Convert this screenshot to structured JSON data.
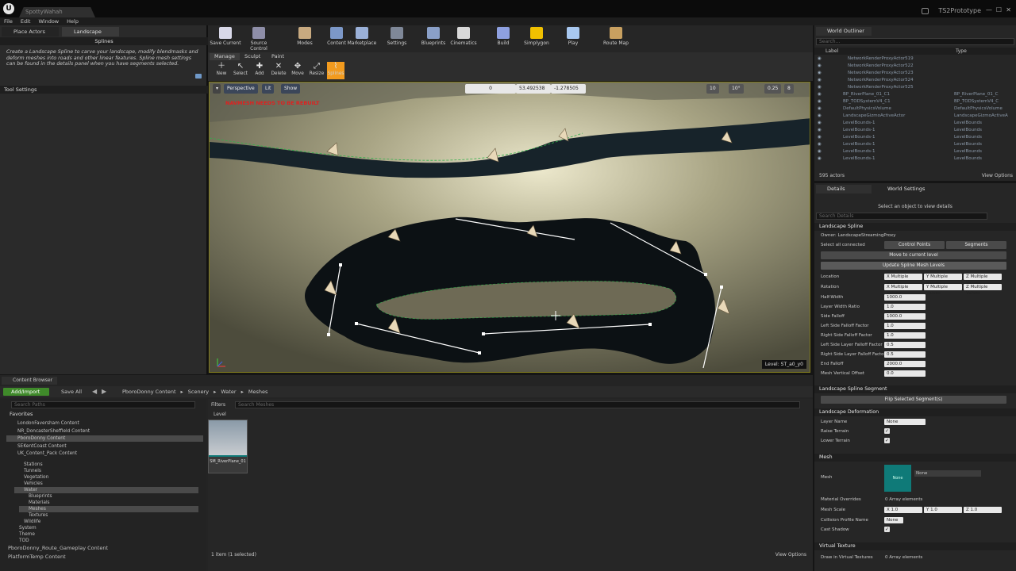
{
  "titlebar": {
    "doc_tab": "SpottyWahah",
    "project": "TS2Prototype"
  },
  "menu": [
    "File",
    "Edit",
    "Window",
    "Help"
  ],
  "left_panel": {
    "tabs": [
      "Place Actors",
      "Landscape"
    ],
    "header": "Splines",
    "description": "Create a Landscape Spline to carve your landscape, modify blendmasks and deform meshes into roads and other linear features.  Spline mesh settings can be found in the details panel when you have  segments selected.",
    "tool_settings": "Tool Settings"
  },
  "toolbar": [
    {
      "label": "Save Current",
      "color": "#d8d8e8"
    },
    {
      "label": "Source Control",
      "color": "#8e8ea8"
    },
    {
      "label": "Modes",
      "color": "#c8aa80"
    },
    {
      "label": "Content",
      "color": "#7c98c8"
    },
    {
      "label": "Marketplace",
      "color": "#9ab0d8"
    },
    {
      "label": "Settings",
      "color": "#7f8898"
    },
    {
      "label": "Blueprints",
      "color": "#8aa0c8"
    },
    {
      "label": "Cinematics",
      "color": "#d8d8d8"
    },
    {
      "label": "Build",
      "color": "#8ea0e0"
    },
    {
      "label": "Simplygon",
      "color": "#f0c000"
    },
    {
      "label": "Play",
      "color": "#a8c8f0"
    },
    {
      "label": "Route Map",
      "color": "#c8a060"
    }
  ],
  "modes": {
    "tabs": [
      "Manage",
      "Sculpt",
      "Paint"
    ],
    "tools": [
      "New",
      "Select",
      "Add",
      "Delete",
      "Move",
      "Resize",
      "Splines"
    ]
  },
  "viewport": {
    "perspective": "Perspective",
    "lit": "Lit",
    "show": "Show",
    "coord_x": "0",
    "coord_y": "53.492538",
    "coord_z": "-1.278505",
    "grid": "10",
    "rot": "10°",
    "scale": "0.25",
    "cam": "8",
    "warning": "NAVMESH NEEDS TO BE REBUILT",
    "level": "Level:  ST_a0_y0"
  },
  "outliner": {
    "title": "World Outliner",
    "search": "Search...",
    "col_label": "Label",
    "col_type": "Type",
    "rows": [
      {
        "label": "NetworkRenderProxyActor519",
        "type": ""
      },
      {
        "label": "NetworkRenderProxyActor522",
        "type": ""
      },
      {
        "label": "NetworkRenderProxyActor523",
        "type": ""
      },
      {
        "label": "NetworkRenderProxyActor524",
        "type": ""
      },
      {
        "label": "NetworkRenderProxyActor525",
        "type": ""
      },
      {
        "label": "BP_RiverPlane_01_C1",
        "type": "BP_RiverPlane_01_C"
      },
      {
        "label": "BP_TODSystemV4_C1",
        "type": "BP_TODSystemV4_C"
      },
      {
        "label": "DefaultPhysicsVolume",
        "type": "DefaultPhysicsVolume"
      },
      {
        "label": "LandscapeGizmoActiveActor",
        "type": "LandscapeGizmoActiveA"
      },
      {
        "label": "LevelBounds-1",
        "type": "LevelBounds"
      },
      {
        "label": "LevelBounds-1",
        "type": "LevelBounds"
      },
      {
        "label": "LevelBounds-1",
        "type": "LevelBounds"
      },
      {
        "label": "LevelBounds-1",
        "type": "LevelBounds"
      },
      {
        "label": "LevelBounds-1",
        "type": "LevelBounds"
      },
      {
        "label": "LevelBounds-1",
        "type": "LevelBounds"
      }
    ],
    "count": "595 actors",
    "view_options": "View Options"
  },
  "details": {
    "tabs": [
      "Details",
      "World Settings"
    ],
    "hint": "Select an object to view details",
    "search": "Search Details",
    "spline": {
      "header": "Landscape Spline",
      "owner": "Owner: LandscapeStreamingProxy",
      "select_all": "Select all connected",
      "control_points": "Control Points",
      "segments": "Segments",
      "move_level": "Move to current level",
      "update_mesh": "Update Spline Mesh Levels",
      "location": "Location",
      "rotation": "Rotation",
      "mv_x": "X  Multiple Values",
      "mv_y": "Y  Multiple Values",
      "mv_z": "Z  Multiple Values",
      "props": [
        {
          "label": "Half-Width",
          "value": "1000.0"
        },
        {
          "label": "Layer Width Ratio",
          "value": "1.0"
        },
        {
          "label": "Side Falloff",
          "value": "1000.0"
        },
        {
          "label": "Left Side Falloff Factor",
          "value": "1.0"
        },
        {
          "label": "Right Side Falloff Factor",
          "value": "1.0"
        },
        {
          "label": "Left Side Layer Falloff Factor",
          "value": "0.5"
        },
        {
          "label": "Right Side Layer Falloff Factor",
          "value": "0.5"
        },
        {
          "label": "End Falloff",
          "value": "2000.0"
        },
        {
          "label": "Mesh Vertical Offset",
          "value": "0.0"
        }
      ]
    },
    "segment": {
      "header": "Landscape Spline Segment",
      "flip": "Flip Selected Segment(s)"
    },
    "deformation": {
      "header": "Landscape Deformation",
      "layer_name": "Layer Name",
      "layer_value": "None",
      "raise": "Raise Terrain",
      "lower": "Lower Terrain"
    },
    "mesh": {
      "header": "Mesh",
      "mesh_label": "Mesh",
      "thumb": "None",
      "dropdown": "None",
      "overrides": "Material Overrides",
      "overrides_val": "0 Array elements",
      "scale": "Mesh Scale",
      "sx": "X  1.0",
      "sy": "Y  1.0",
      "sz": "Z  1.0",
      "collision": "Collision Profile Name",
      "collision_val": "None",
      "shadow": "Cast Shadow"
    },
    "vt": {
      "header": "Virtual Texture",
      "draw": "Draw in Virtual Textures",
      "draw_val": "0 Array elements"
    }
  },
  "content_browser": {
    "tab": "Content Browser",
    "add_import": "Add/Import",
    "save_all": "Save All",
    "path": [
      "PboroDonny Content",
      "Scenery",
      "Water",
      "Meshes"
    ],
    "search_paths": "Search Paths",
    "favorites": "Favorites",
    "fav_items": [
      "LondonFaversham Content",
      "NR_DoncasterSheffield Content",
      "PboroDonny Content",
      "SEKentCoast Content",
      "UK_Content_Pack Content"
    ],
    "tree": [
      "Stations",
      "Tunnels",
      "Vegetation",
      "Vehicles",
      "Water",
      "Blueprints",
      "Materials",
      "Meshes",
      "Textures",
      "Wildlife",
      "System",
      "Theme",
      "TOD"
    ],
    "root1": "PboroDonny_Route_Gameplay Content",
    "root2": "PlatformTemp Content",
    "filters": "Filters",
    "search_meshes": "Search Meshes",
    "level": "Level",
    "asset": "SM_RiverPlane_01",
    "status": "1 item (1 selected)",
    "view_options": "View Options"
  }
}
